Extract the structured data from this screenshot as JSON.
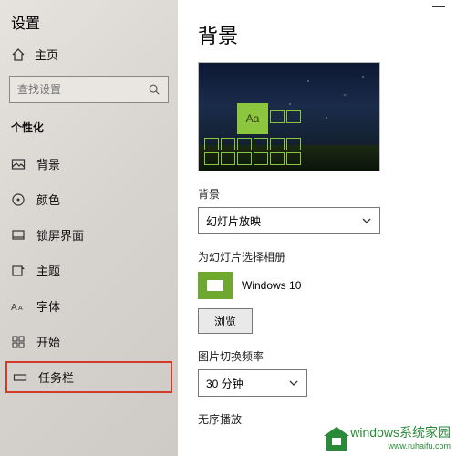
{
  "window": {
    "app_label": "设置"
  },
  "sidebar": {
    "home": "主页",
    "search_placeholder": "查找设置",
    "section": "个性化",
    "items": [
      {
        "label": "背景"
      },
      {
        "label": "颜色"
      },
      {
        "label": "锁屏界面"
      },
      {
        "label": "主题"
      },
      {
        "label": "字体"
      },
      {
        "label": "开始"
      },
      {
        "label": "任务栏"
      }
    ]
  },
  "main": {
    "title": "背景",
    "preview_tile_text": "Aa",
    "bg_label": "背景",
    "bg_value": "幻灯片放映",
    "album_label": "为幻灯片选择相册",
    "album_name": "Windows 10",
    "browse": "浏览",
    "interval_label": "图片切换频率",
    "interval_value": "30 分钟",
    "shuffle_label": "无序播放"
  },
  "watermark": {
    "brand": "windows系统家园",
    "url": "www.ruhaifu.com"
  }
}
